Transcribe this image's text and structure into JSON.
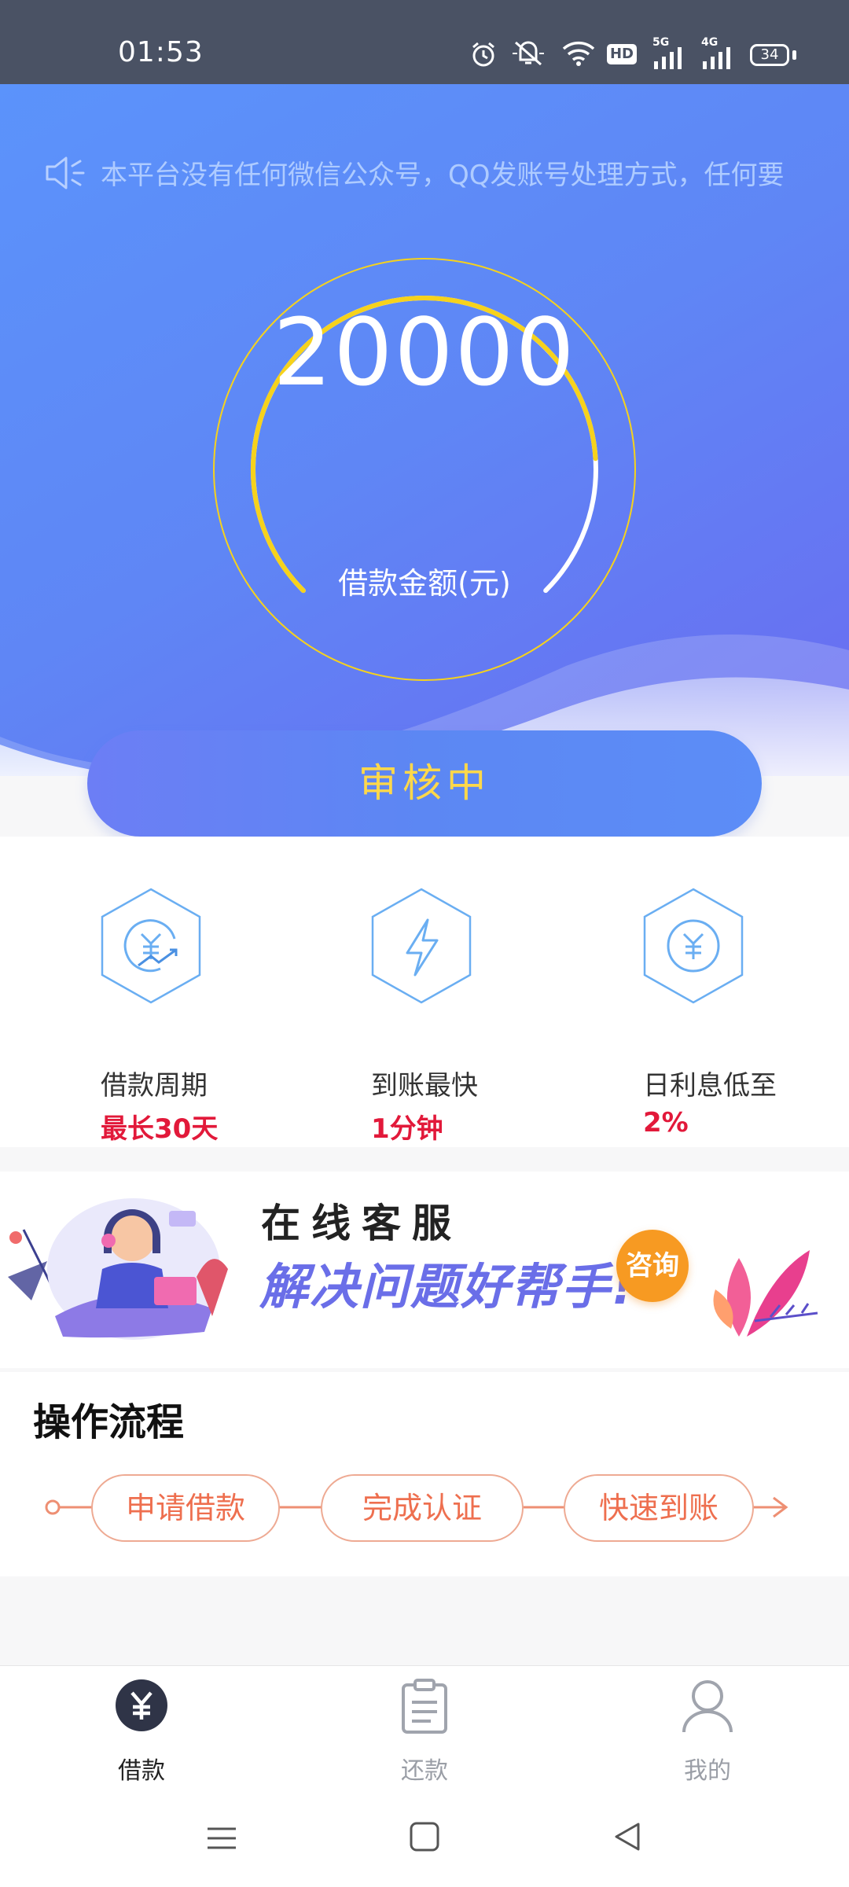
{
  "status_bar": {
    "time": "01:53",
    "icons": [
      "alarm-icon",
      "mute-icon",
      "wifi-icon",
      "hd-icon",
      "signal-5g-icon",
      "signal-4g-icon",
      "battery-icon"
    ],
    "hd_label": "HD",
    "net1_label": "5G",
    "net2_label": "4G",
    "battery_level": "34"
  },
  "notice": {
    "icon": "speaker-icon",
    "text": "本平台没有任何微信公众号，QQ发账号处理方式，任何要"
  },
  "loan": {
    "amount": "20000",
    "amount_label": "借款金额(元)",
    "gauge_progress": 0.82
  },
  "review_button": {
    "label": "审核中"
  },
  "features": [
    {
      "icon": "yuan-cycle-icon",
      "title": "借款周期",
      "value": "最长30天"
    },
    {
      "icon": "lightning-icon",
      "title": "到账最快",
      "value": "1分钟"
    },
    {
      "icon": "yuan-coin-icon",
      "title": "日利息低至",
      "value": "2%"
    }
  ],
  "service_banner": {
    "title": "在线客服",
    "slogan": "解决问题好帮手!",
    "consult_label": "咨询"
  },
  "process": {
    "title": "操作流程",
    "steps": [
      "申请借款",
      "完成认证",
      "快速到账"
    ]
  },
  "tabbar": {
    "active": "借款",
    "items": [
      {
        "label": "借款",
        "icon": "yuan-icon"
      },
      {
        "label": "还款",
        "icon": "clipboard-icon"
      },
      {
        "label": "我的",
        "icon": "user-icon"
      }
    ]
  },
  "colors": {
    "accent_blue": "#5b8ef6",
    "gauge_yellow": "#f6d21c",
    "highlight_red": "#e2193a",
    "step_orange": "#ee6f4f",
    "consult_orange": "#f79a22"
  }
}
